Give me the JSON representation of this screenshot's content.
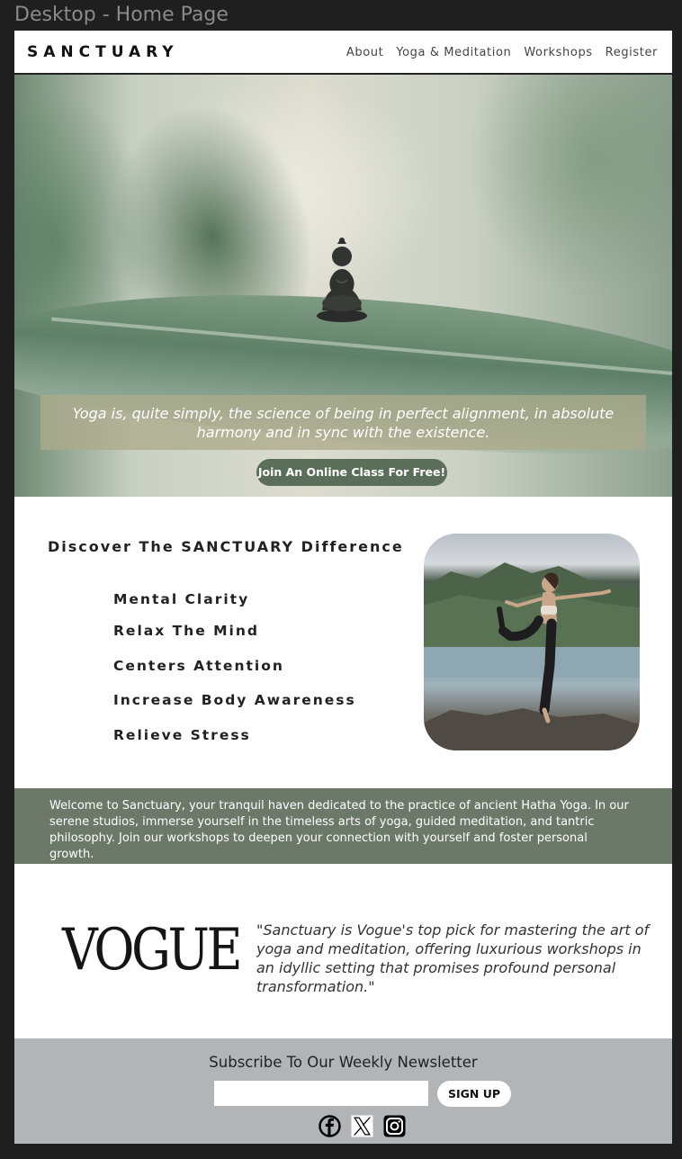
{
  "frame": {
    "title": "Desktop - Home Page"
  },
  "nav": {
    "brand": "SANCTUARY",
    "links": [
      "About",
      "Yoga & Meditation",
      "Workshops",
      "Register"
    ]
  },
  "hero": {
    "quote": "Yoga is, quite simply, the science of being in perfect alignment, in absolute harmony and in sync with the existence.",
    "cta_label": "Join An Online Class For Free!"
  },
  "difference": {
    "title": "Discover The SANCTUARY Difference",
    "benefits": [
      "Mental Clarity",
      "Relax The Mind",
      "Centers Attention",
      "Increase Body Awareness",
      "Relieve Stress"
    ]
  },
  "welcome": {
    "text": "Welcome to Sanctuary, your tranquil haven dedicated to the practice of ancient Hatha Yoga. In our serene studios, immerse yourself in the timeless arts of yoga, guided meditation, and tantric philosophy. Join our workshops to deepen your connection with yourself and foster personal growth."
  },
  "press": {
    "logo": "VOGUE",
    "quote": "\"Sanctuary is Vogue's top pick for mastering the art of yoga and meditation, offering luxurious workshops in an idyllic setting that promises profound personal transformation.\""
  },
  "newsletter": {
    "title": "Subscribe To Our Weekly Newsletter",
    "input_value": "",
    "button_label": "SIGN UP",
    "socials": [
      "facebook-icon",
      "x-icon",
      "instagram-icon"
    ]
  },
  "colors": {
    "accent_green": "#6c7868",
    "cta_green": "#5b6e59",
    "newsletter_grey": "#b1b5b7"
  }
}
